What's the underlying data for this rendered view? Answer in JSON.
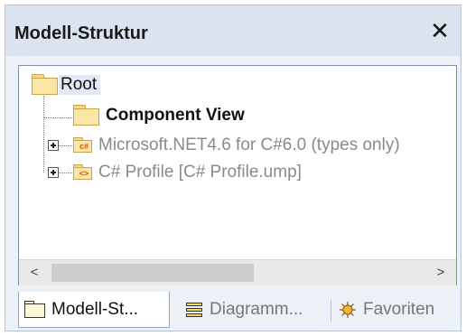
{
  "panel": {
    "title": "Modell-Struktur",
    "close_glyph": "✕"
  },
  "tree": {
    "root": {
      "label": "Root",
      "icon": "folder-icon"
    },
    "children": [
      {
        "label": "Component View",
        "icon": "folder-icon",
        "expandable": false,
        "state": "normal"
      },
      {
        "label": "Microsoft.NET4.6 for C#6.0 (types only)",
        "icon": "csharp-folder-icon",
        "badge": "c#",
        "expandable": true,
        "state": "disabled"
      },
      {
        "label": "C# Profile [C# Profile.ump]",
        "icon": "profile-folder-icon",
        "badge": "<>",
        "expandable": true,
        "state": "disabled"
      }
    ]
  },
  "scrollbar": {
    "left_glyph": "<",
    "right_glyph": ">"
  },
  "tabs": [
    {
      "label": "Modell-St...",
      "icon": "folder-icon",
      "active": true
    },
    {
      "label": "Diagramm...",
      "icon": "diagram-icon",
      "active": false
    },
    {
      "label": "Favoriten",
      "icon": "favorites-icon",
      "active": false
    }
  ],
  "colors": {
    "title_bar": "#dbe3ef",
    "panel_bg": "#ecf0f7",
    "root_highlight": "#e3e8f5",
    "folder_fill": "#fbe6a6",
    "disabled_text": "#8a8a8a"
  }
}
